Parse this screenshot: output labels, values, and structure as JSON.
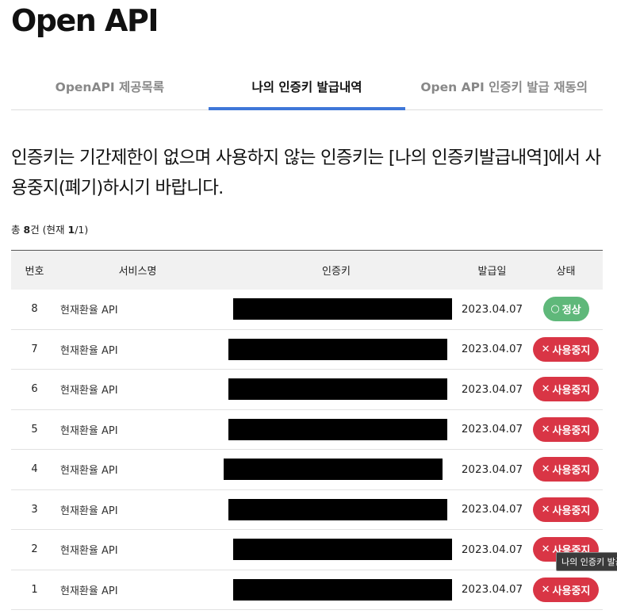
{
  "page": {
    "title": "Open API"
  },
  "tabs": [
    {
      "label": "OpenAPI 제공목록"
    },
    {
      "label": "나의 인증키 발급내역"
    },
    {
      "label": "Open API 인증키 발급 재동의"
    }
  ],
  "notice": "인증키는 기간제한이 없으며 사용하지 않는 인증키는 [나의 인증키발급내역]에서 사용중지(폐기)하시기 바랍니다.",
  "count": {
    "prefix": "총 ",
    "total": "8",
    "middle": "건 (현재 ",
    "current": "1",
    "suffix": "/1)"
  },
  "table": {
    "headers": {
      "no": "번호",
      "service": "서비스명",
      "key": "인증키",
      "date": "발급일",
      "status": "상태"
    },
    "rows": [
      {
        "no": "8",
        "service": "현재환율 API",
        "date": "2023.04.07",
        "status": "정상",
        "status_type": "normal",
        "status_icon": "○"
      },
      {
        "no": "7",
        "service": "현재환율 API",
        "date": "2023.04.07",
        "status": "사용중지",
        "status_type": "stopped",
        "status_icon": "✕"
      },
      {
        "no": "6",
        "service": "현재환율 API",
        "date": "2023.04.07",
        "status": "사용중지",
        "status_type": "stopped",
        "status_icon": "✕"
      },
      {
        "no": "5",
        "service": "현재환율 API",
        "date": "2023.04.07",
        "status": "사용중지",
        "status_type": "stopped",
        "status_icon": "✕"
      },
      {
        "no": "4",
        "service": "현재환율 API",
        "date": "2023.04.07",
        "status": "사용중지",
        "status_type": "stopped",
        "status_icon": "✕"
      },
      {
        "no": "3",
        "service": "현재환율 API",
        "date": "2023.04.07",
        "status": "사용중지",
        "status_type": "stopped",
        "status_icon": "✕"
      },
      {
        "no": "2",
        "service": "현재환율 API",
        "date": "2023.04.07",
        "status": "사용중지",
        "status_type": "stopped",
        "status_icon": "✕"
      },
      {
        "no": "1",
        "service": "현재환율 API",
        "date": "2023.04.07",
        "status": "사용중지",
        "status_type": "stopped",
        "status_icon": "✕"
      }
    ]
  },
  "tooltip": "나의 인증키 발급",
  "colors": {
    "accent": "#3f77d8",
    "normal": "#5fb87a",
    "stopped": "#d93545",
    "redaction": "#000000"
  }
}
